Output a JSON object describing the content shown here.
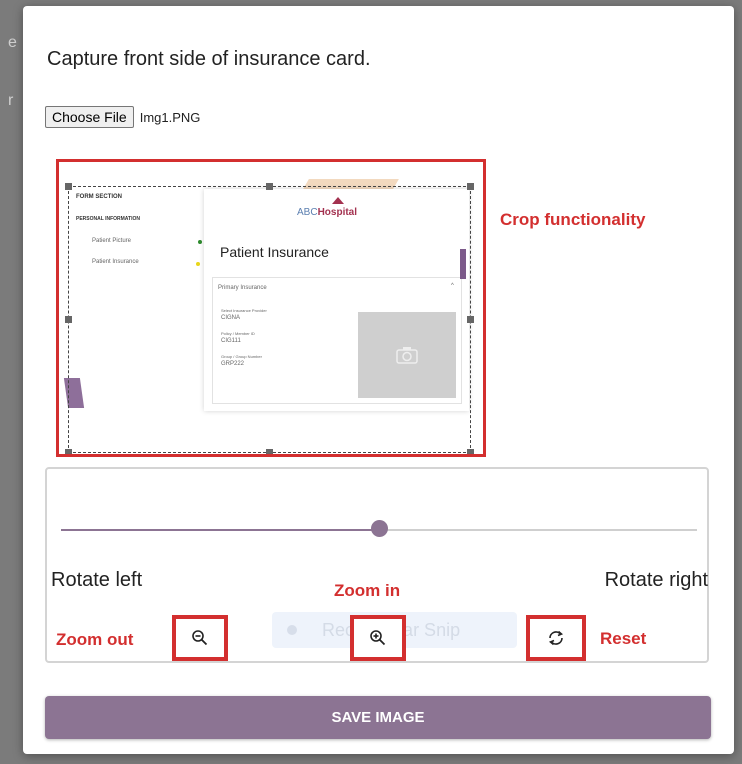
{
  "background_fragments": [
    "e",
    "r"
  ],
  "modal": {
    "title": "Capture front side of insurance card.",
    "file_input": {
      "button_label": "Choose File",
      "file_name": "Img1.PNG"
    },
    "crop_annotation": "Crop functionality",
    "preview": {
      "section_header": "FORM SECTION",
      "personal_info": "PERSONAL INFORMATION",
      "nav_items": [
        "Patient Picture",
        "Patient Insurance"
      ],
      "logo_prefix": "ABC",
      "logo_suffix": "Hospital",
      "heading": "Patient Insurance",
      "panel_title": "Primary Insurance",
      "fields": [
        {
          "label": "Select Insurance Provider",
          "value": "CIGNA"
        },
        {
          "label": "Policy / Member ID",
          "value": "CIG111"
        },
        {
          "label": "Group / Group Number",
          "value": "GRP222"
        }
      ]
    },
    "controls": {
      "slider_value_fraction": 0.5,
      "rotate_left": "Rotate left",
      "rotate_right": "Rotate right",
      "zoom_in_annotation": "Zoom in",
      "zoom_out_annotation": "Zoom out",
      "reset_annotation": "Reset",
      "ghost_text": "Rectangular Snip"
    },
    "save_label": "SAVE IMAGE"
  },
  "colors": {
    "accent": "#8c7493",
    "annotation": "#d32f2f"
  },
  "icons": [
    "zoom-out-icon",
    "zoom-in-icon",
    "reset-icon",
    "camera-icon"
  ]
}
